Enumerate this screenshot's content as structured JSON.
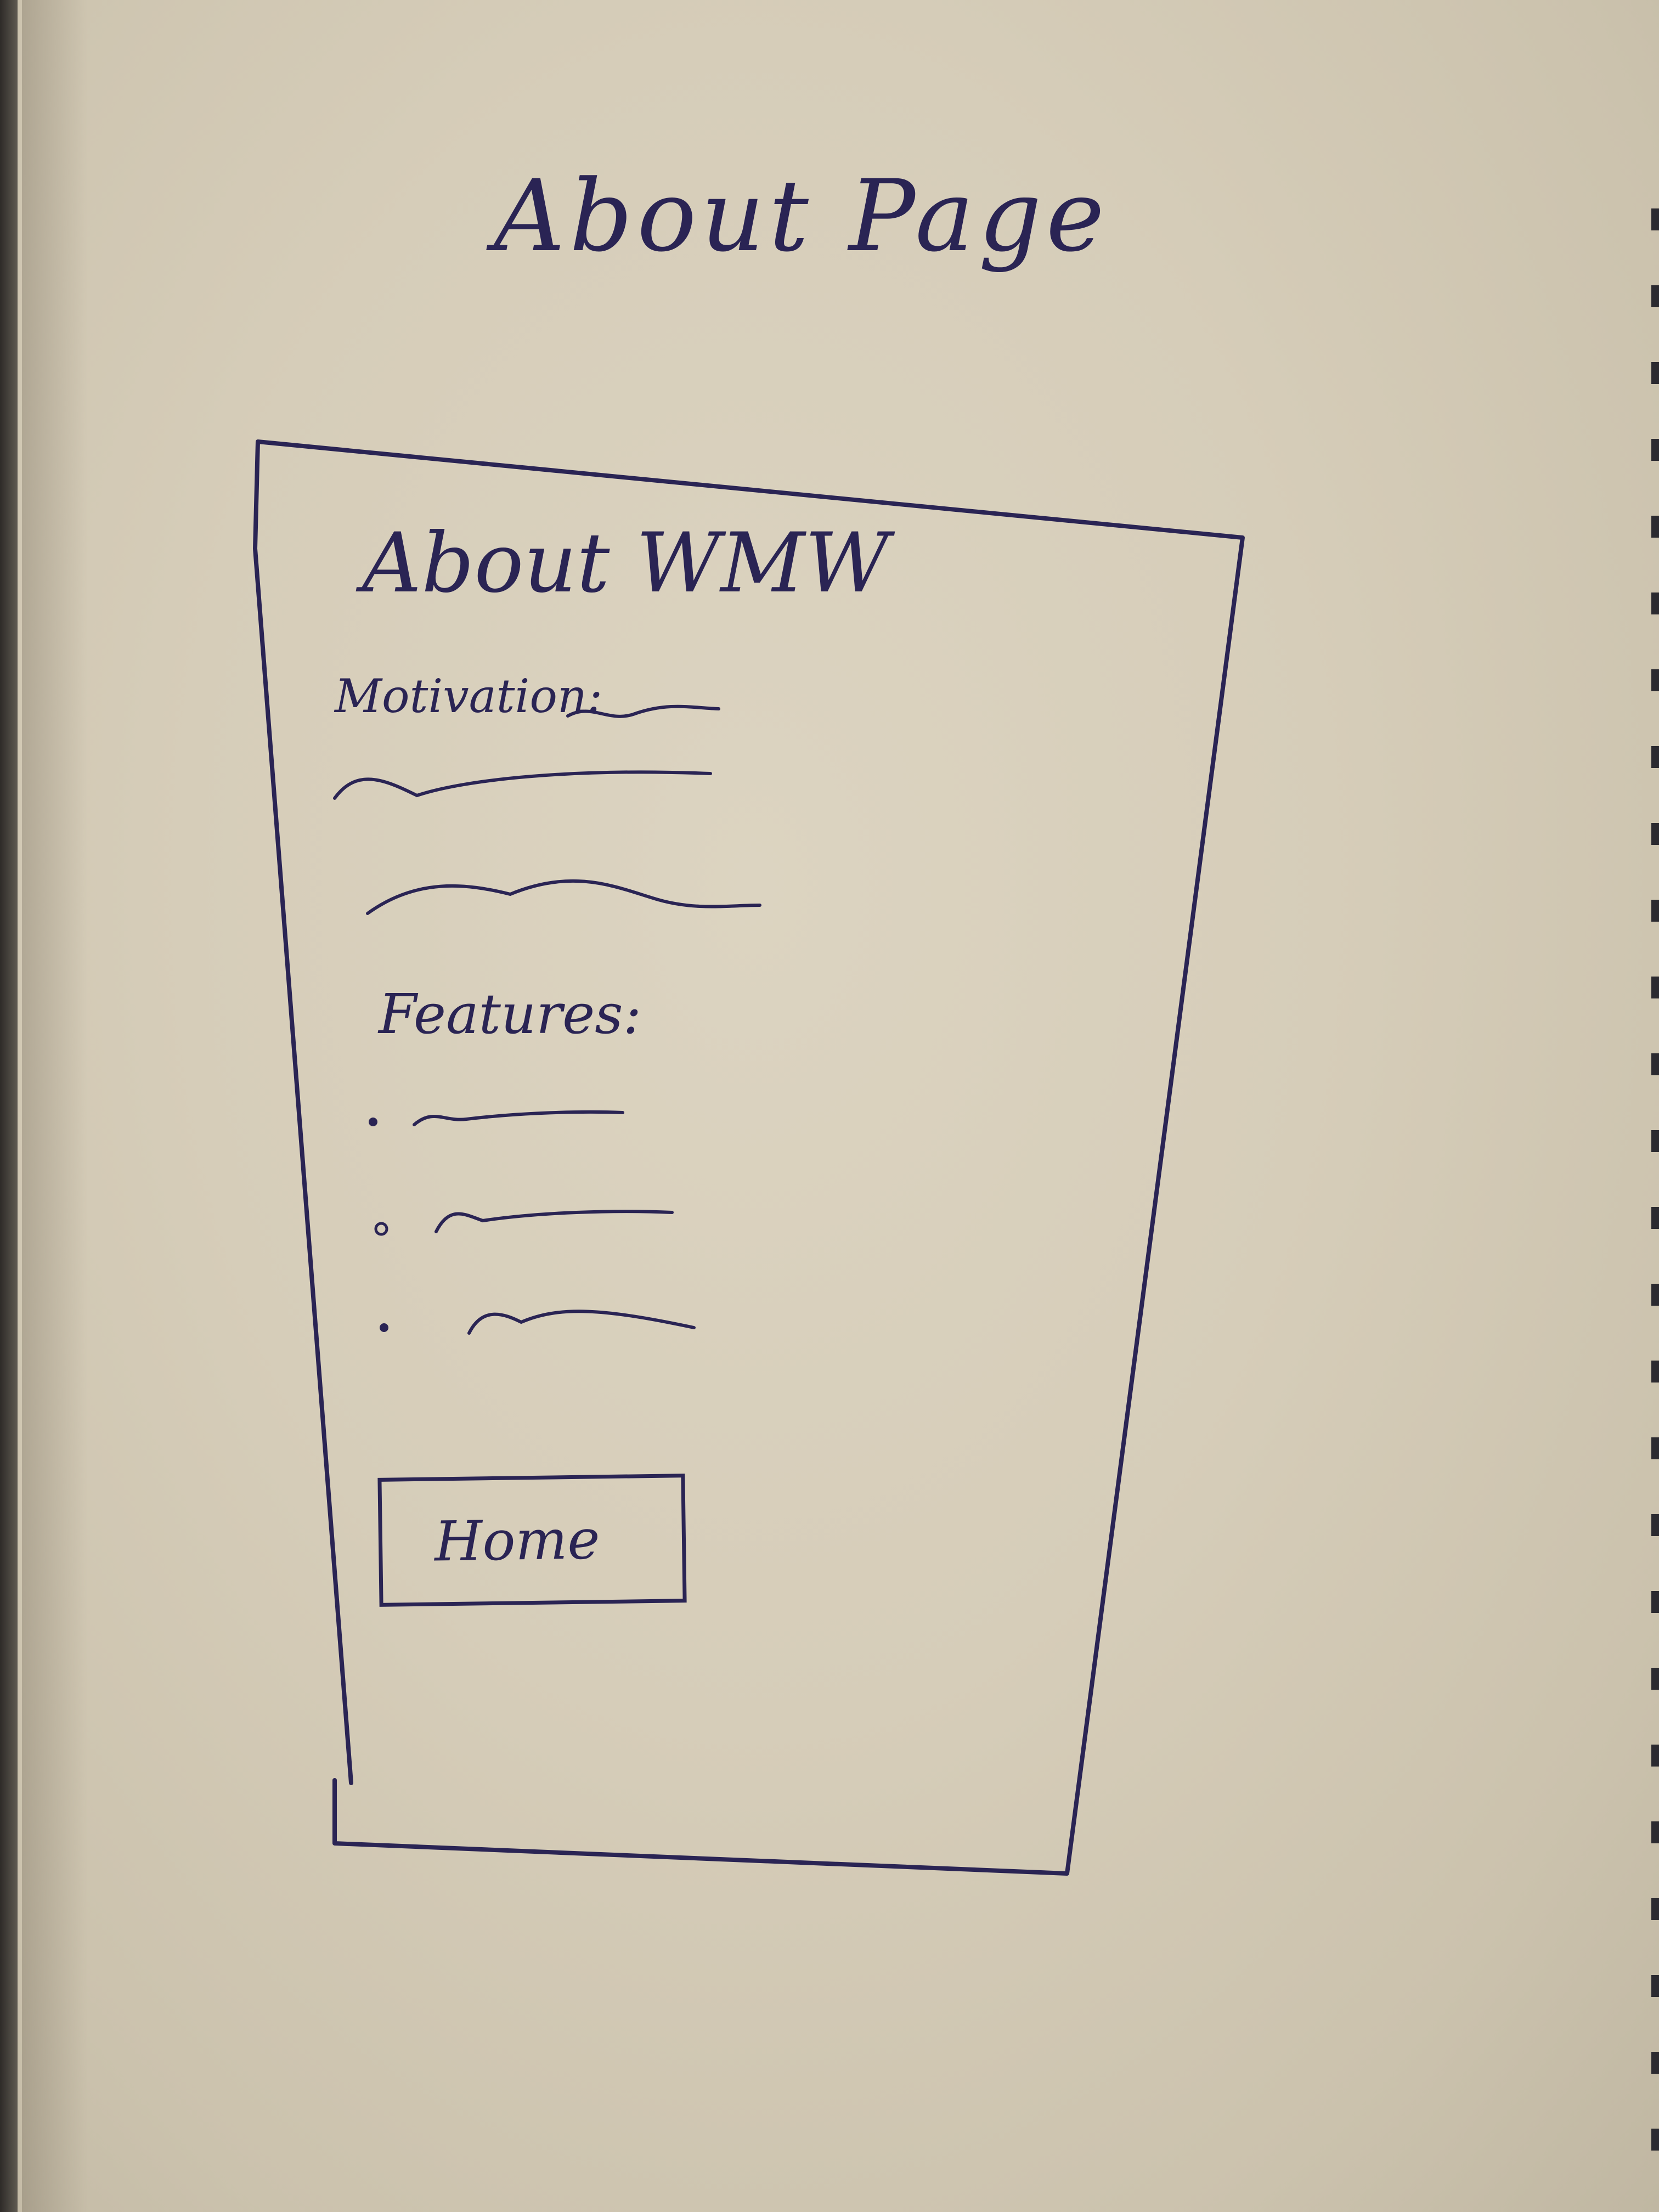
{
  "sketch": {
    "title": "About Page",
    "ink_color": "#2a2454",
    "paper_color": "#d6cdb9"
  },
  "wireframe": {
    "heading": "About WMW",
    "motivation_label": "Motivation:",
    "features_label": "Features:",
    "feature_bullet_count": 3,
    "home_button_label": "Home"
  }
}
